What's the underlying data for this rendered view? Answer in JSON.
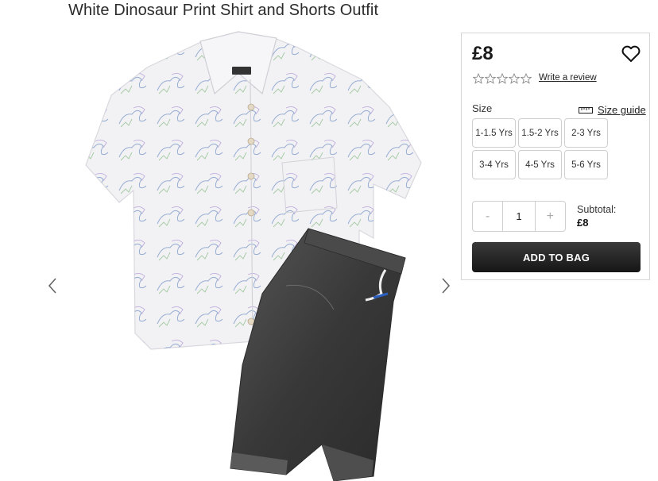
{
  "product": {
    "title": "White Dinosaur Print Shirt and Shorts Outfit",
    "price": "£8",
    "review_link": "Write a review",
    "rating_stars": 5,
    "colors": {
      "button_dark": "#1e1e1e",
      "border": "#d6d6d6",
      "shirt": "#f3f3f6",
      "denim": "#3b3b3b"
    }
  },
  "size": {
    "label": "Size",
    "guide_label": "Size guide",
    "options": [
      "1-1.5 Yrs",
      "1.5-2 Yrs",
      "2-3 Yrs",
      "3-4 Yrs",
      "4-5 Yrs",
      "5-6 Yrs"
    ]
  },
  "quantity": {
    "minus": "-",
    "value": "1",
    "plus": "+"
  },
  "subtotal": {
    "label": "Subtotal:",
    "value": "£8"
  },
  "actions": {
    "add_to_bag": "ADD TO BAG"
  },
  "icons": {
    "wishlist": "heart-icon",
    "prev": "chevron-left-icon",
    "next": "chevron-right-icon",
    "size_guide": "ruler-icon"
  }
}
